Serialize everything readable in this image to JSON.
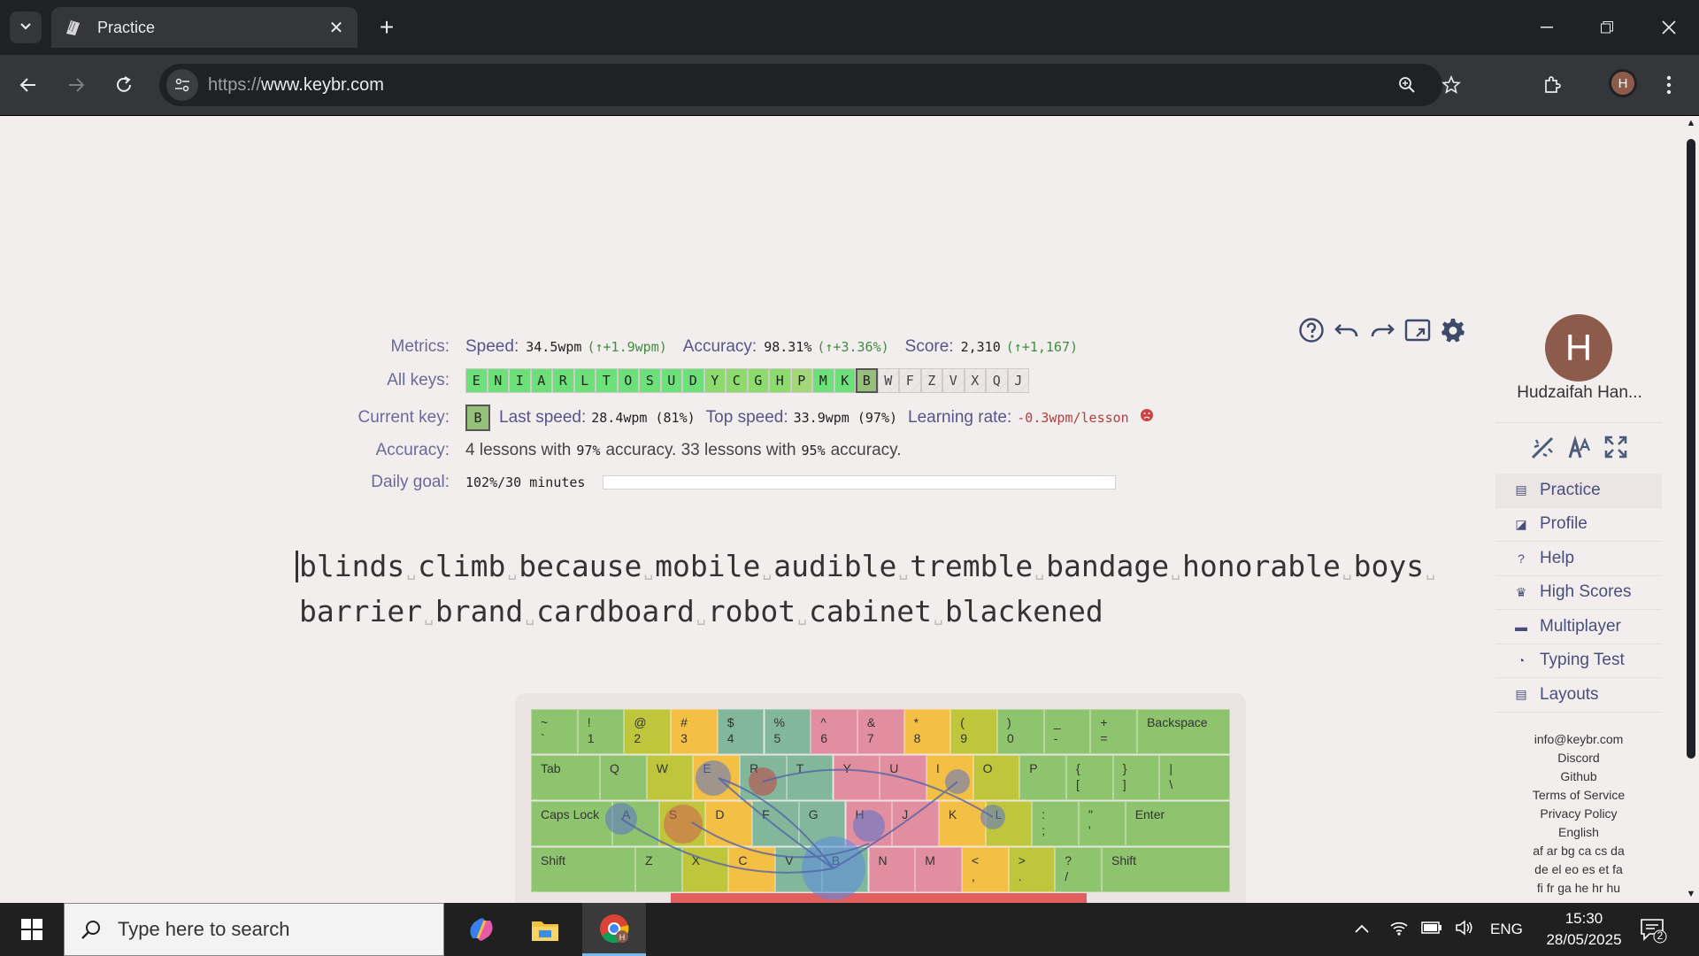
{
  "browser": {
    "tab_title": "Practice",
    "url_scheme": "https://",
    "url_host": "www.keybr.com",
    "avatar_letter": "H"
  },
  "stats": {
    "metrics_label": "Metrics:",
    "speed_label": "Speed:",
    "speed_value": "34.5wpm",
    "speed_delta": "(↑+1.9wpm)",
    "accuracy_label": "Accuracy:",
    "accuracy_value": "98.31%",
    "accuracy_delta": "(↑+3.36%)",
    "score_label": "Score:",
    "score_value": "2,310",
    "score_delta": "(↑+1,167)",
    "all_keys_label": "All keys:",
    "all_keys": [
      {
        "k": "E",
        "s": "g1"
      },
      {
        "k": "N",
        "s": "g1"
      },
      {
        "k": "I",
        "s": "g1"
      },
      {
        "k": "A",
        "s": "g1"
      },
      {
        "k": "R",
        "s": "g1"
      },
      {
        "k": "L",
        "s": "g1"
      },
      {
        "k": "T",
        "s": "g1"
      },
      {
        "k": "O",
        "s": "g1"
      },
      {
        "k": "S",
        "s": "g1"
      },
      {
        "k": "U",
        "s": "g1"
      },
      {
        "k": "D",
        "s": "g1"
      },
      {
        "k": "Y",
        "s": "g2"
      },
      {
        "k": "C",
        "s": "g2"
      },
      {
        "k": "G",
        "s": "g2"
      },
      {
        "k": "H",
        "s": "g2"
      },
      {
        "k": "P",
        "s": "g3"
      },
      {
        "k": "M",
        "s": "g1"
      },
      {
        "k": "K",
        "s": "g1"
      },
      {
        "k": "B",
        "s": "current"
      },
      {
        "k": "W",
        "s": "locked"
      },
      {
        "k": "F",
        "s": "locked"
      },
      {
        "k": "Z",
        "s": "locked"
      },
      {
        "k": "V",
        "s": "locked"
      },
      {
        "k": "X",
        "s": "locked"
      },
      {
        "k": "Q",
        "s": "locked"
      },
      {
        "k": "J",
        "s": "locked"
      }
    ],
    "current_key_label": "Current key:",
    "current_key": "B",
    "last_speed_label": "Last speed:",
    "last_speed_value": "28.4wpm (81%)",
    "top_speed_label": "Top speed:",
    "top_speed_value": "33.9wpm (97%)",
    "learning_rate_label": "Learning rate:",
    "learning_rate_value": "-0.3wpm/lesson",
    "accuracy_row_label": "Accuracy:",
    "acc_text_1": "4 lessons with",
    "acc_pct_1": "97%",
    "acc_text_2": "accuracy. 33 lessons with",
    "acc_pct_2": "95%",
    "acc_text_3": "accuracy.",
    "daily_goal_label": "Daily goal:",
    "daily_goal_value": "102%/30 minutes",
    "daily_goal_progress": 1.02
  },
  "typing": {
    "line1": [
      "blinds",
      "climb",
      "because",
      "mobile",
      "audible",
      "tremble",
      "bandage",
      "honorable",
      "boys"
    ],
    "line2": [
      "barrier",
      "brand",
      "cardboard",
      "robot",
      "cabinet",
      "blackened"
    ]
  },
  "keyboard": {
    "row1": [
      {
        "t": "~",
        "b": "`",
        "c": "c-green"
      },
      {
        "t": "!",
        "b": "1",
        "c": "c-green"
      },
      {
        "t": "@",
        "b": "2",
        "c": "c-olive"
      },
      {
        "t": "#",
        "b": "3",
        "c": "c-orange"
      },
      {
        "t": "$",
        "b": "4",
        "c": "c-teal"
      },
      {
        "t": "%",
        "b": "5",
        "c": "c-teal"
      },
      {
        "t": "^",
        "b": "6",
        "c": "c-pink"
      },
      {
        "t": "&",
        "b": "7",
        "c": "c-pink"
      },
      {
        "t": "*",
        "b": "8",
        "c": "c-orange"
      },
      {
        "t": "(",
        "b": "9",
        "c": "c-olive"
      },
      {
        "t": ")",
        "b": "0",
        "c": "c-green"
      },
      {
        "t": "_",
        "b": "-",
        "c": "c-green"
      },
      {
        "t": "+",
        "b": "=",
        "c": "c-green"
      }
    ],
    "backspace": "Backspace",
    "tab": "Tab",
    "row2": [
      {
        "t": "Q",
        "c": "c-green"
      },
      {
        "t": "W",
        "c": "c-olive"
      },
      {
        "t": "E",
        "c": "c-orange"
      },
      {
        "t": "R",
        "c": "c-teal"
      },
      {
        "t": "T",
        "c": "c-teal"
      },
      {
        "t": "Y",
        "c": "c-pink"
      },
      {
        "t": "U",
        "c": "c-pink"
      },
      {
        "t": "I",
        "c": "c-orange"
      },
      {
        "t": "O",
        "c": "c-olive"
      },
      {
        "t": "P",
        "c": "c-green"
      },
      {
        "t": "{",
        "b": "[",
        "c": "c-green"
      },
      {
        "t": "}",
        "b": "]",
        "c": "c-green"
      },
      {
        "t": "|",
        "b": "\\",
        "c": "c-green"
      }
    ],
    "caps": "Caps Lock",
    "row3": [
      {
        "t": "A",
        "c": "c-green"
      },
      {
        "t": "S",
        "c": "c-olive"
      },
      {
        "t": "D",
        "c": "c-orange"
      },
      {
        "t": "F",
        "c": "c-teal"
      },
      {
        "t": "G",
        "c": "c-teal"
      },
      {
        "t": "H",
        "c": "c-pink"
      },
      {
        "t": "J",
        "c": "c-pink"
      },
      {
        "t": "K",
        "c": "c-orange"
      },
      {
        "t": "L",
        "c": "c-olive"
      },
      {
        "t": ":",
        "b": ";",
        "c": "c-green"
      },
      {
        "t": "\"",
        "b": "'",
        "c": "c-green"
      }
    ],
    "enter": "Enter",
    "shift": "Shift",
    "row4": [
      {
        "t": "Z",
        "c": "c-green"
      },
      {
        "t": "X",
        "c": "c-olive"
      },
      {
        "t": "C",
        "c": "c-orange"
      },
      {
        "t": "V",
        "c": "c-teal"
      },
      {
        "t": "B",
        "c": "c-teal"
      },
      {
        "t": "N",
        "c": "c-pink"
      },
      {
        "t": "M",
        "c": "c-pink"
      },
      {
        "t": "<",
        "b": ",",
        "c": "c-orange"
      },
      {
        "t": ">",
        "b": ".",
        "c": "c-olive"
      },
      {
        "t": "?",
        "b": "/",
        "c": "c-green"
      }
    ]
  },
  "sidebar": {
    "avatar_letter": "H",
    "user_name": "Hudzaifah Han...",
    "menu": [
      {
        "label": "Practice",
        "icon": "keyboard-icon",
        "glyph": "▤",
        "active": true
      },
      {
        "label": "Profile",
        "icon": "chart-icon",
        "glyph": "◪",
        "active": false
      },
      {
        "label": "Help",
        "icon": "help-icon",
        "glyph": "?",
        "active": false
      },
      {
        "label": "High Scores",
        "icon": "trophy-icon",
        "glyph": "♛",
        "active": false
      },
      {
        "label": "Multiplayer",
        "icon": "car-icon",
        "glyph": "▬",
        "active": false
      },
      {
        "label": "Typing Test",
        "icon": "gauge-icon",
        "glyph": "◔",
        "active": false
      },
      {
        "label": "Layouts",
        "icon": "keyboard-icon",
        "glyph": "▤",
        "active": false
      }
    ],
    "footer": [
      "info@keybr.com",
      "Discord",
      "Github",
      "Terms of Service",
      "Privacy Policy",
      "English",
      "af ar bg ca cs da",
      "de el eo es et fa",
      "fi fr ga he hr hu"
    ]
  },
  "taskbar": {
    "search_placeholder": "Type here to search",
    "lang": "ENG",
    "time": "15:30",
    "date": "28/05/2025",
    "notif_count": "2"
  }
}
